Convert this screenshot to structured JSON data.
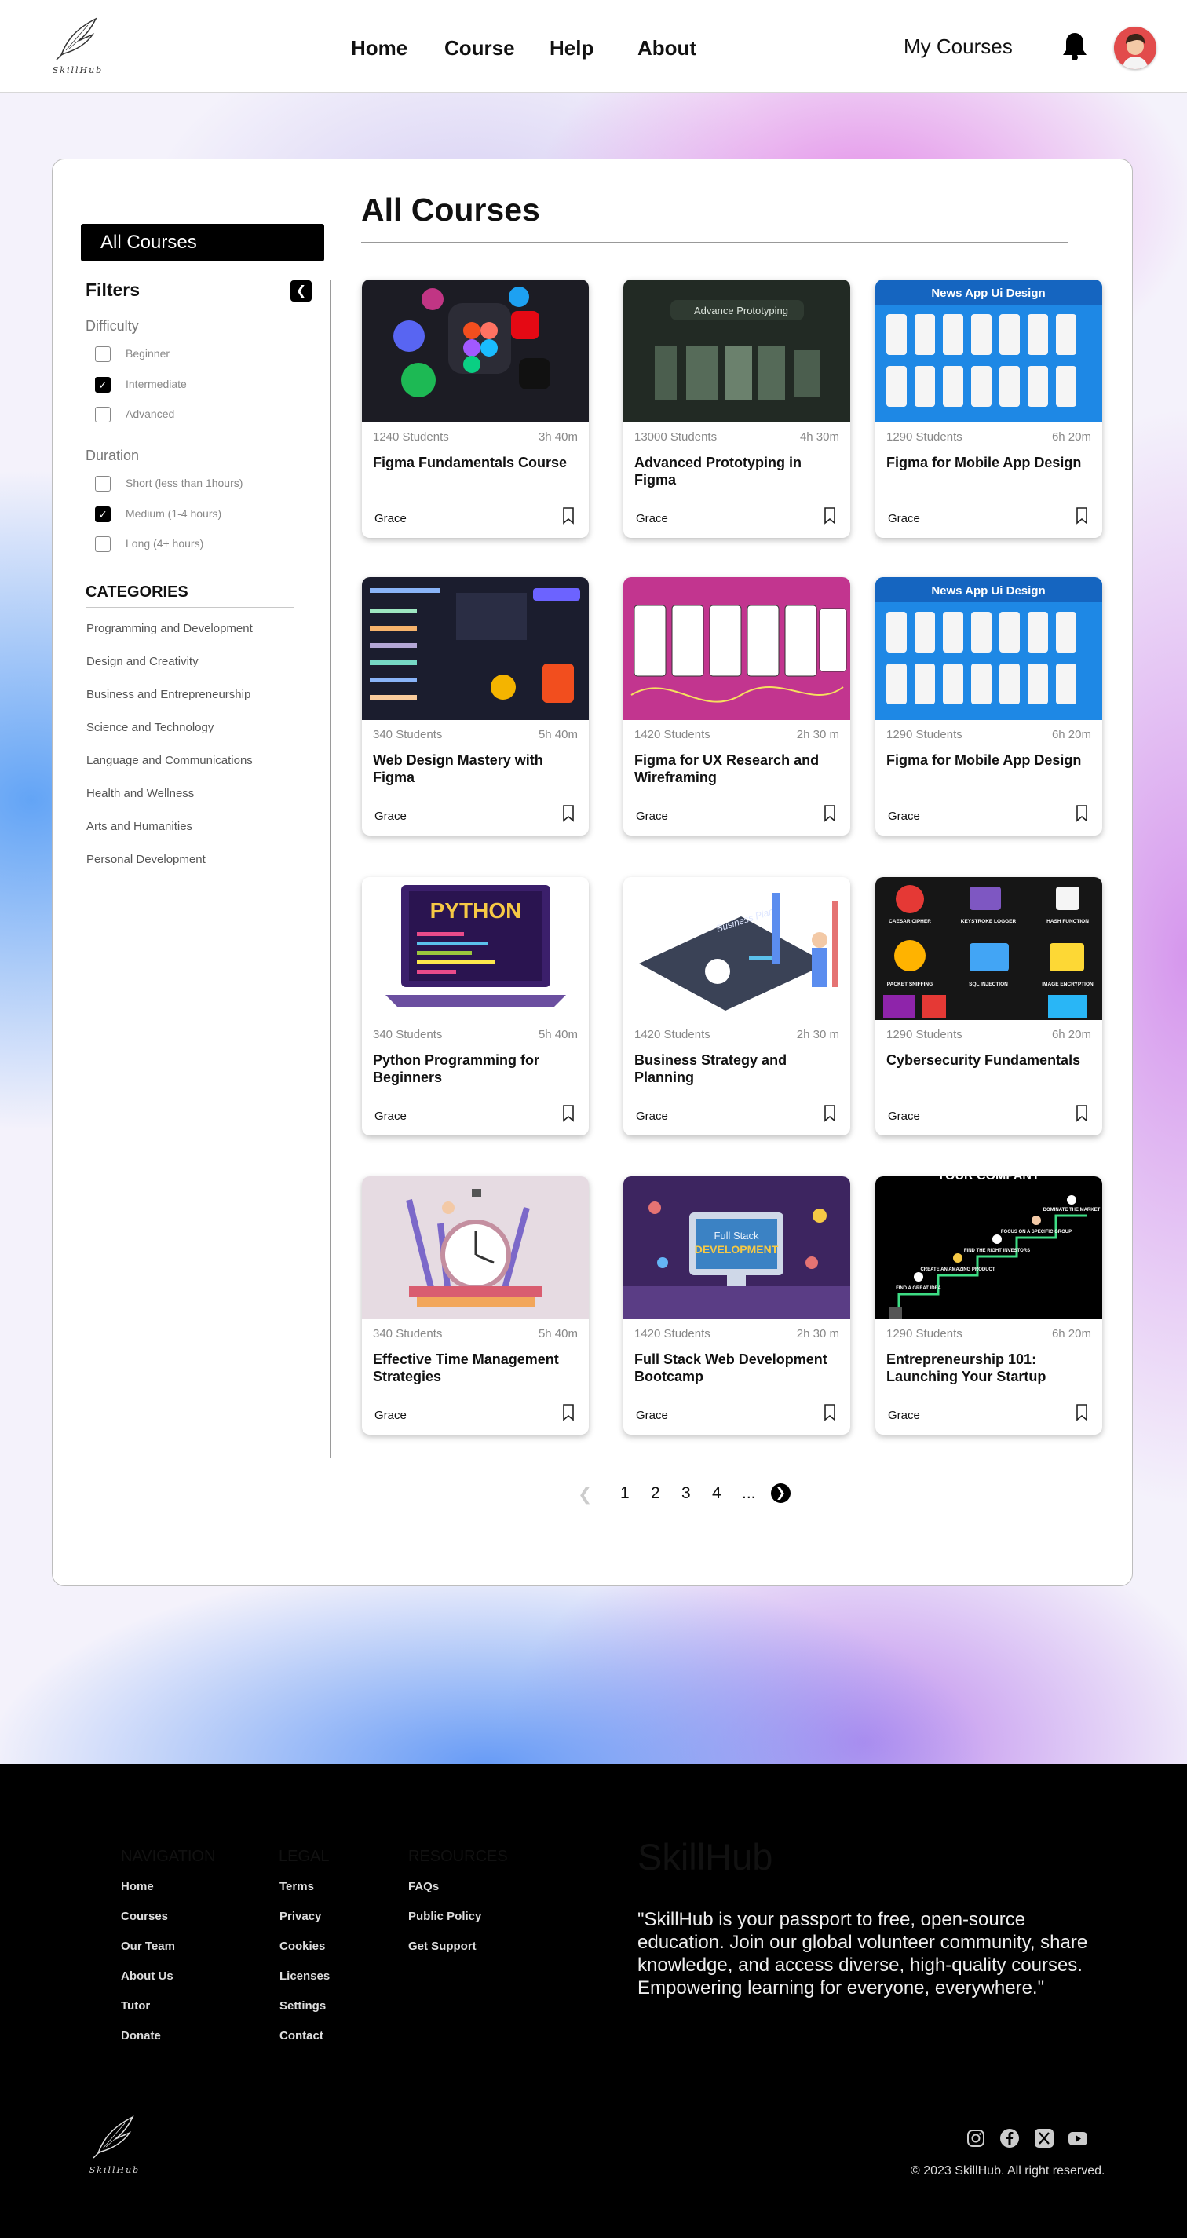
{
  "header": {
    "logo_text": "SkillHub",
    "nav": [
      "Home",
      "Course",
      "Help",
      "About"
    ],
    "my_courses": "My Courses"
  },
  "sidebar": {
    "all_courses": "All Courses",
    "filters": "Filters",
    "difficulty": {
      "title": "Difficulty",
      "options": [
        {
          "label": "Beginner",
          "checked": false
        },
        {
          "label": "Intermediate",
          "checked": true
        },
        {
          "label": "Advanced",
          "checked": false
        }
      ]
    },
    "duration": {
      "title": "Duration",
      "options": [
        {
          "label": "Short (less than 1hours)",
          "checked": false
        },
        {
          "label": "Medium (1-4 hours)",
          "checked": true
        },
        {
          "label": "Long (4+ hours)",
          "checked": false
        }
      ]
    },
    "categories_title": "CATEGORIES",
    "categories": [
      "Programming and Development",
      "Design and Creativity",
      "Business and Entrepreneurship",
      "Science and Technology",
      "Language and Communications",
      "Health and Wellness",
      "Arts and Humanities",
      "Personal Development"
    ]
  },
  "main": {
    "title": "All Courses",
    "courses": [
      {
        "students": "1240 Students",
        "duration": "3h 40m",
        "title": "Figma Fundamentals Course",
        "author": "Grace"
      },
      {
        "students": "13000 Students",
        "duration": "4h 30m",
        "title": "Advanced Prototyping in Figma",
        "author": "Grace",
        "thumb_text": "Advance Prototyping"
      },
      {
        "students": "1290 Students",
        "duration": "6h 20m",
        "title": "Figma for Mobile App Design",
        "author": "Grace",
        "thumb_text": "News App Ui Design"
      },
      {
        "students": "340 Students",
        "duration": "5h 40m",
        "title": "Web Design Mastery with Figma",
        "author": "Grace"
      },
      {
        "students": "1420 Students",
        "duration": "2h 30 m",
        "title": "Figma for UX Research and Wireframing",
        "author": "Grace"
      },
      {
        "students": "1290 Students",
        "duration": "6h 20m",
        "title": "Figma for Mobile App Design",
        "author": "Grace",
        "thumb_text": "News App Ui Design"
      },
      {
        "students": "340 Students",
        "duration": "5h 40m",
        "title": "Python Programming for Beginners",
        "author": "Grace",
        "thumb_text": "PYTHON"
      },
      {
        "students": "1420 Students",
        "duration": "2h 30 m",
        "title": "Business Strategy and Planning",
        "author": "Grace",
        "thumb_text": "Business Plan"
      },
      {
        "students": "1290 Students",
        "duration": "6h 20m",
        "title": "Cybersecurity Fundamentals",
        "author": "Grace",
        "thumb_labels": [
          "CAESAR CIPHER",
          "KEYSTROKE LOGGER",
          "HASH FUNCTION",
          "PACKET SNIFFING",
          "SQL INJECTION",
          "IMAGE ENCRYPTION"
        ]
      },
      {
        "students": "340 Students",
        "duration": "5h 40m",
        "title": "Effective Time Management Strategies",
        "author": "Grace"
      },
      {
        "students": "1420 Students",
        "duration": "2h 30 m",
        "title": "Full Stack Web Development Bootcamp",
        "author": "Grace",
        "thumb_text": "Full Stack",
        "thumb_text2": "DEVELOPMENT"
      },
      {
        "students": "1290 Students",
        "duration": "6h 20m",
        "title": "Entrepreneurship 101: Launching Your Startup",
        "author": "Grace",
        "thumb_text": "YOUR COMPANY",
        "thumb_labels": [
          "FIND A GREAT IDEA",
          "CREATE AN AMAZING PRODUCT",
          "FIND THE RIGHT INVESTORS",
          "FOCUS ON A SPECIFIC GROUP",
          "DOMINATE THE MARKET"
        ]
      }
    ],
    "pagination": [
      "1",
      "2",
      "3",
      "4",
      "..."
    ]
  },
  "footer": {
    "navigation": {
      "title": "NAVIGATION",
      "links": [
        "Home",
        "Courses",
        "Our Team",
        "About Us",
        "Tutor",
        "Donate"
      ]
    },
    "legal": {
      "title": "LEGAL",
      "links": [
        "Terms",
        "Privacy",
        "Cookies",
        "Licenses",
        "Settings",
        "Contact"
      ]
    },
    "resources": {
      "title": "RESOURCES",
      "links": [
        "FAQs",
        "Public Policy",
        "Get Support"
      ]
    },
    "brand": "SkillHub",
    "description": "\"SkillHub is your passport to free, open-source education. Join our global volunteer community, share knowledge, and access diverse, high-quality courses. Empowering learning for everyone, everywhere.\"",
    "logo_text": "SkillHub",
    "copyright": "© 2023 SkillHub. All right reserved.",
    "social_icons": [
      "instagram-icon",
      "facebook-icon",
      "x-icon",
      "youtube-icon"
    ]
  }
}
